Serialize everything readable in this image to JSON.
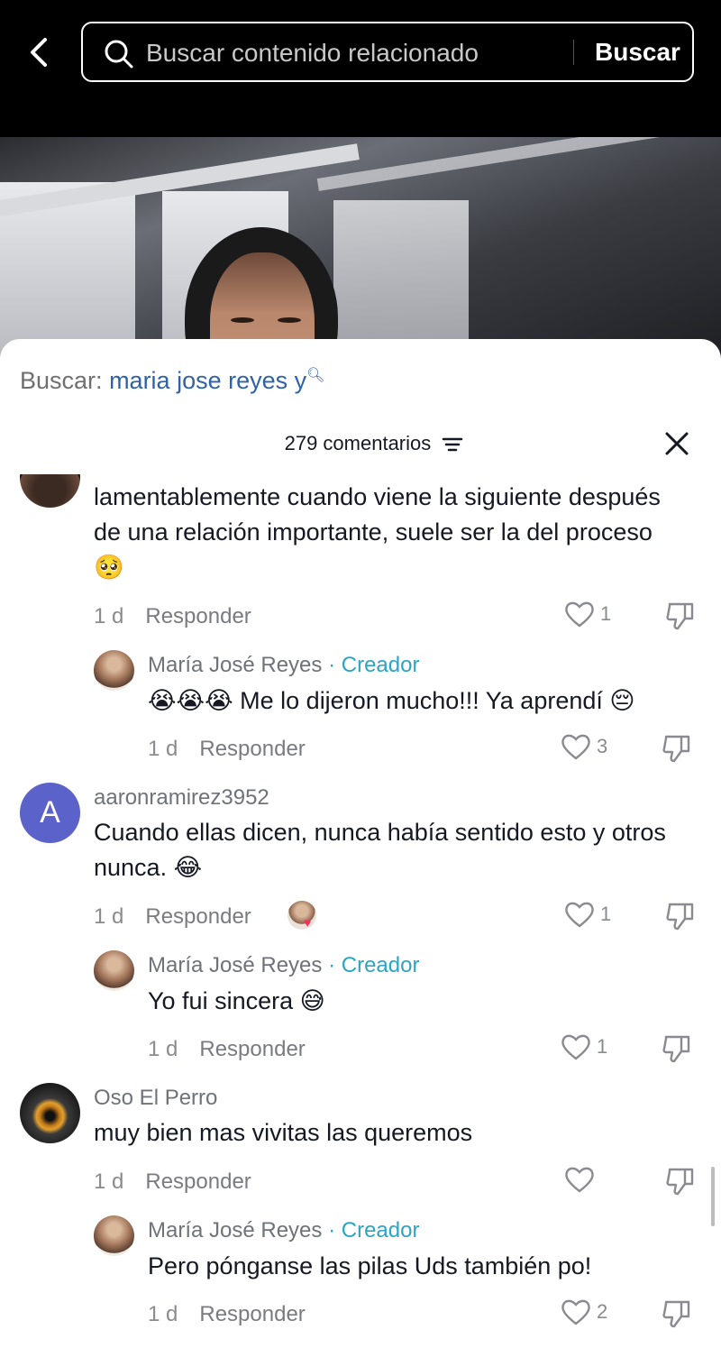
{
  "search": {
    "placeholder": "Buscar contenido relacionado",
    "button": "Buscar"
  },
  "sheet": {
    "related_label": "Buscar:",
    "related_query": "maria jose reyes y",
    "comments_count": "279 comentarios"
  },
  "comments": [
    {
      "text": "lamentablemente cuando viene la siguiente después de una relación importante, suele ser la del proceso 🥺",
      "time": "1 d",
      "reply": "Responder",
      "likes": "1"
    },
    {
      "user": "María José Reyes",
      "tag": "· Creador",
      "text": "😭😭😭 Me lo dijeron mucho!!! Ya aprendí 😔",
      "time": "1 d",
      "reply": "Responder",
      "likes": "3"
    },
    {
      "user": "aaronramirez3952",
      "avatar_letter": "A",
      "text": "Cuando ellas dicen, nunca había sentido esto y otros nunca. 😂",
      "time": "1 d",
      "reply": "Responder",
      "likes": "1"
    },
    {
      "user": "María José Reyes",
      "tag": "· Creador",
      "text": "Yo fui sincera 😅",
      "time": "1 d",
      "reply": "Responder",
      "likes": "1"
    },
    {
      "user": "Oso El Perro",
      "text": "muy bien mas vivitas las queremos",
      "time": "1 d",
      "reply": "Responder",
      "likes": ""
    },
    {
      "user": "María José Reyes",
      "tag": "· Creador",
      "text": "Pero pónganse las pilas Uds también po!",
      "time": "1 d",
      "reply": "Responder",
      "likes": "2"
    }
  ],
  "icons": {
    "back": "chevron-left-icon",
    "search": "search-icon",
    "filter": "filter-icon",
    "close": "close-icon",
    "like": "heart-icon",
    "dislike": "thumbs-down-icon"
  },
  "colors": {
    "creator_tag": "#2aa5c4",
    "query": "#2f62a8",
    "avatar_letter_bg": "#5b62c9"
  }
}
